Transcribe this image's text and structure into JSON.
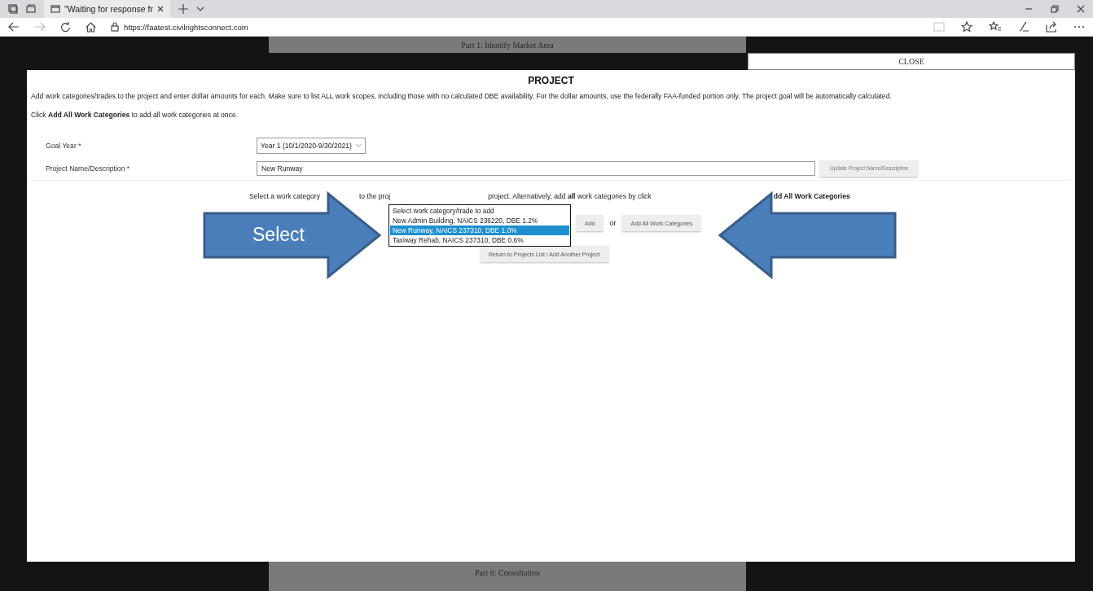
{
  "browser": {
    "tab_title": "\"Waiting for response fr",
    "url_host": "https://faatest.civilrightsconnect.com"
  },
  "background": {
    "top_section": "Part 1: Identify Market Area",
    "bottom_section": "Part 6: Consultation"
  },
  "dialog": {
    "close": "CLOSE",
    "title": "PROJECT",
    "intro": "Add work categories/trades to the project and enter dollar amounts for each. Make sure to list ALL work scopes, including those with no calculated DBE availability. For the dollar amounts, use the federally FAA-funded portion only. The project goal will be automatically calculated.",
    "hint": "Click **Add All Work Categories** to add all work categories at once.",
    "fields": [
      {
        "label": "Goal Year *",
        "kind": "select",
        "value": "Year 1 (10/1/2020-9/30/2021)"
      },
      {
        "label": "Project Name/Description *",
        "kind": "text",
        "value": "New Runway",
        "button": "Update Project Name/Description"
      }
    ],
    "instruction_parts": [
      "Select a work category",
      "to the proj",
      "project. Alternatively, add **all** work categories by click",
      "dd All Work Categories"
    ],
    "category_options": [
      {
        "label": "Select work category/trade to add",
        "selected": false
      },
      {
        "label": "New Admin Building, NAICS 236220, DBE 1.2%",
        "selected": false
      },
      {
        "label": "New Runway, NAICS 237310, DBE 1.0%",
        "selected": true
      },
      {
        "label": "Taxiway Rehab, NAICS 237310, DBE 0.6%",
        "selected": false
      }
    ],
    "add_button": "Add",
    "or": "or",
    "add_all_button": "Add All Work Categories",
    "return_button": "Return to Projects List / Add Another Project"
  },
  "callouts": [
    {
      "kind": "right",
      "label": "Select"
    },
    {
      "kind": "left"
    }
  ]
}
